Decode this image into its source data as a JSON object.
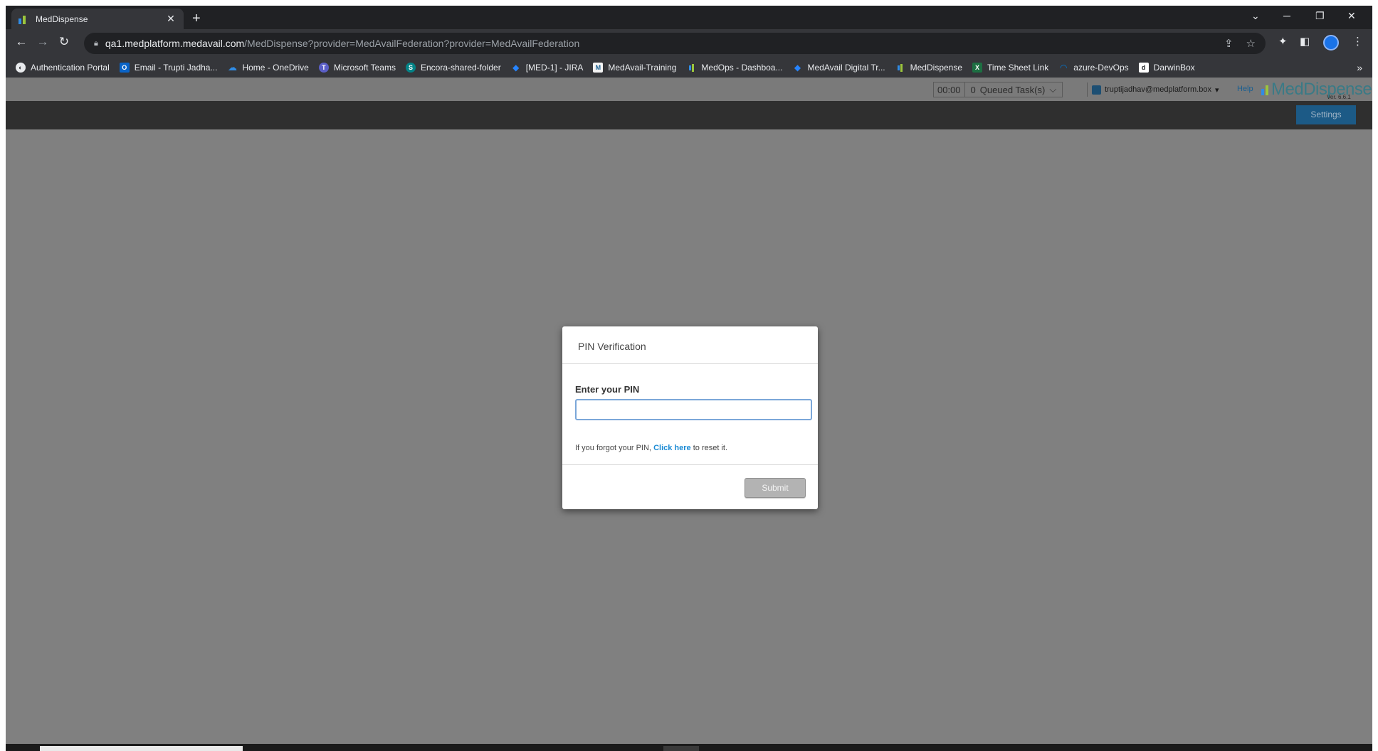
{
  "browser": {
    "tab_title": "MedDispense",
    "new_tab": "+",
    "tab_close": "✕",
    "url_host": "qa1.medplatform.medavail.com",
    "url_path": "/MedDispense?provider=MedAvailFederation?provider=MedAvailFederation",
    "more_bookmarks": "»"
  },
  "bookmarks": [
    {
      "label": "Authentication Portal",
      "icon": "portal-icon",
      "color": "#e8eaed"
    },
    {
      "label": "Email - Trupti Jadha...",
      "icon": "outlook-icon",
      "color": "#0a64c8"
    },
    {
      "label": "Home - OneDrive",
      "icon": "onedrive-icon",
      "color": "#2f8ce6"
    },
    {
      "label": "Microsoft Teams",
      "icon": "teams-icon",
      "color": "#5b5fc7"
    },
    {
      "label": "Encora-shared-folder",
      "icon": "sharepoint-icon",
      "color": "#038387"
    },
    {
      "label": "[MED-1] - JIRA",
      "icon": "jira-icon",
      "color": "#2684ff"
    },
    {
      "label": "MedAvail-Training",
      "icon": "medavail-icon",
      "color": "#f4f4f4"
    },
    {
      "label": "MedOps - Dashboa...",
      "icon": "meddispense-icon",
      "color": "#35363a"
    },
    {
      "label": "MedAvail Digital Tr...",
      "icon": "jira-icon",
      "color": "#2684ff"
    },
    {
      "label": "MedDispense",
      "icon": "meddispense-icon",
      "color": "#35363a"
    },
    {
      "label": "Time Sheet Link",
      "icon": "excel-icon",
      "color": "#1d6f42"
    },
    {
      "label": "azure-DevOps",
      "icon": "azure-devops-icon",
      "color": "#0078d4"
    },
    {
      "label": "DarwinBox",
      "icon": "darwinbox-icon",
      "color": "#ffffff"
    }
  ],
  "app": {
    "timer": "00:00",
    "queued_count": "0",
    "queued_label": "Queued Task(s)",
    "user_email": "truptijadhav@medplatform.box",
    "help": "Help",
    "logo_text": "MedDispense",
    "version": "Ver. 6.6.1",
    "settings": "Settings"
  },
  "modal": {
    "title": "PIN Verification",
    "field_label": "Enter your PIN",
    "pin_value": "",
    "forgot_prefix": "If you forgot your PIN, ",
    "forgot_link": "Click here",
    "forgot_suffix": " to reset it.",
    "submit": "Submit"
  },
  "colors": {
    "overlay": "#808080",
    "nav_bar": "#2f2f2f",
    "settings_button": "#1c5a86",
    "link": "#1a8ad4",
    "logo_green": "#9bc53d",
    "logo_blue": "#3a7a86"
  }
}
